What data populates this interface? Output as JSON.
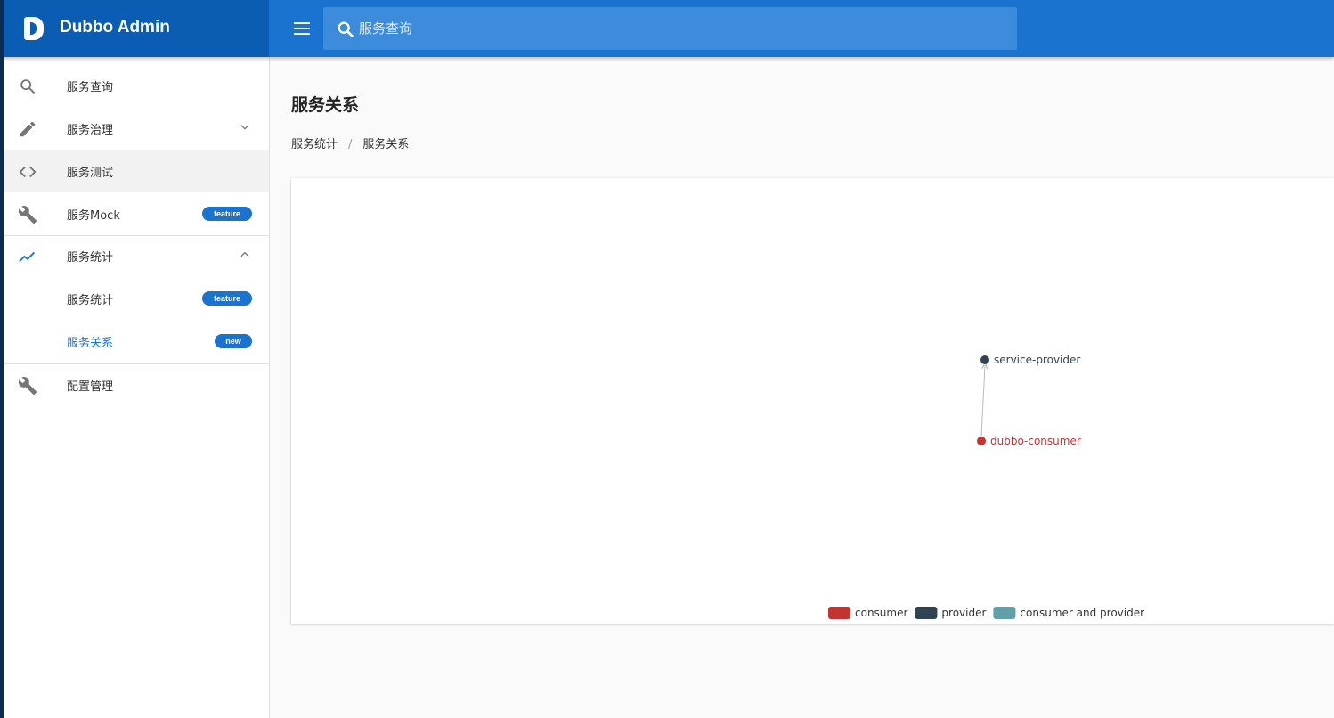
{
  "app": {
    "title": "Dubbo Admin"
  },
  "search": {
    "placeholder": "服务查询"
  },
  "sidebar": {
    "items": [
      {
        "label": "服务查询",
        "icon": "search-icon"
      },
      {
        "label": "服务治理",
        "icon": "pencil-icon",
        "expandable": true,
        "expanded": false
      },
      {
        "label": "服务测试",
        "icon": "code-icon",
        "selected": true
      },
      {
        "label": "服务Mock",
        "icon": "wrench-icon",
        "badge": "feature"
      },
      {
        "label": "服务统计",
        "icon": "trending-up-icon",
        "expandable": true,
        "expanded": true,
        "children": [
          {
            "label": "服务统计",
            "badge": "feature"
          },
          {
            "label": "服务关系",
            "badge": "new",
            "active": true
          }
        ]
      },
      {
        "label": "配置管理",
        "icon": "wrench-icon"
      }
    ]
  },
  "main": {
    "title": "服务关系",
    "breadcrumb": [
      "服务统计",
      "服务关系"
    ]
  },
  "chart_data": {
    "type": "graph",
    "nodes": [
      {
        "name": "service-provider",
        "category": "provider"
      },
      {
        "name": "dubbo-consumer",
        "category": "consumer"
      }
    ],
    "links": [
      {
        "source": "dubbo-consumer",
        "target": "service-provider"
      }
    ],
    "categories": [
      {
        "name": "consumer",
        "color": "#c23531"
      },
      {
        "name": "provider",
        "color": "#2f4554"
      },
      {
        "name": "consumer and provider",
        "color": "#61a0a8"
      }
    ],
    "legend_position": "bottom-center"
  },
  "colors": {
    "primary": "#1a73cf",
    "brand": "#0b5db4",
    "search_bg": "#3d8bdb"
  }
}
